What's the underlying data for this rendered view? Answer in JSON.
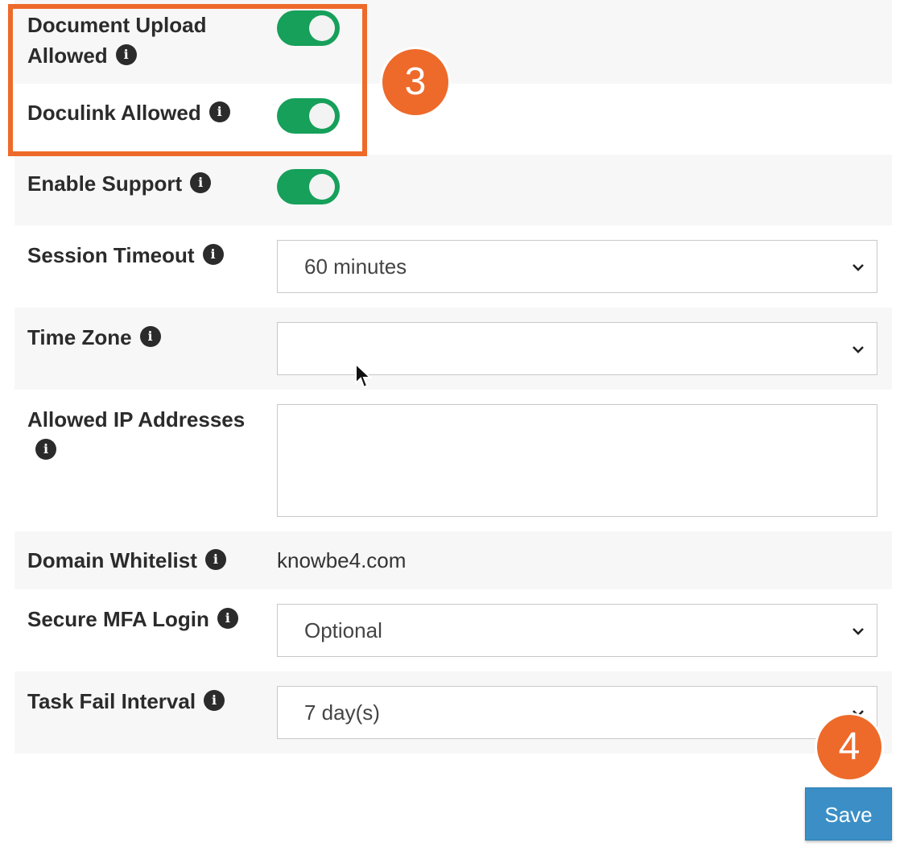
{
  "settings": {
    "document_upload": {
      "label_line1": "Document Upload",
      "label_line2": "Allowed",
      "enabled": true
    },
    "doculink": {
      "label": "Doculink Allowed",
      "enabled": true
    },
    "enable_support": {
      "label": "Enable Support",
      "enabled": true
    },
    "session_timeout": {
      "label": "Session Timeout",
      "value": "60 minutes"
    },
    "time_zone": {
      "label": "Time Zone",
      "value": ""
    },
    "allowed_ip": {
      "label": "Allowed IP Addresses",
      "value": ""
    },
    "domain_whitelist": {
      "label": "Domain Whitelist",
      "value": "knowbe4.com"
    },
    "secure_mfa": {
      "label": "Secure MFA Login",
      "value": "Optional"
    },
    "task_fail_interval": {
      "label": "Task Fail Interval",
      "value": "7 day(s)"
    }
  },
  "actions": {
    "save_label": "Save"
  },
  "annotations": {
    "step3": "3",
    "step4": "4"
  },
  "icons": {
    "info": "info-icon",
    "chevron": "chevron-down-icon",
    "cursor": "mouse-pointer-icon"
  },
  "colors": {
    "accent_orange": "#ee6a2a",
    "toggle_green": "#16a05a",
    "save_blue": "#3b8fc6"
  }
}
